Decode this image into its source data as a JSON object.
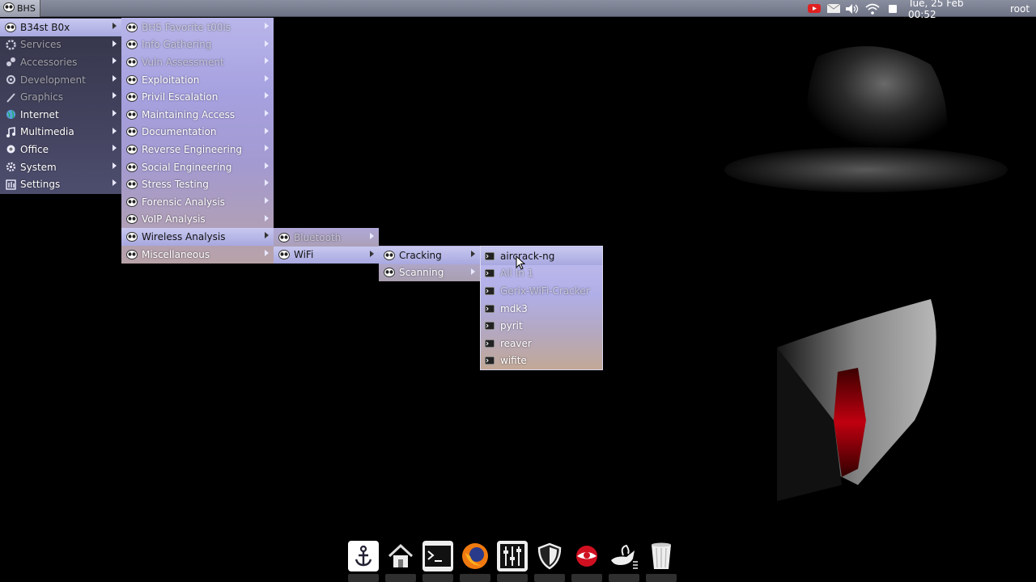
{
  "top_panel": {
    "start_label": "BHS",
    "clock": "Tue, 25 Feb  00:52",
    "user": "root",
    "tray_icons": [
      "youtube-icon",
      "mail-icon",
      "volume-icon",
      "wifi-icon",
      "stop-icon"
    ]
  },
  "main_menu": {
    "items": [
      {
        "label": "B34st B0x",
        "icon": "bhs-icon"
      },
      {
        "label": "Services",
        "icon": "services-icon"
      },
      {
        "label": "Accessories",
        "icon": "accessories-icon"
      },
      {
        "label": "Development",
        "icon": "development-icon"
      },
      {
        "label": "Graphics",
        "icon": "graphics-icon"
      },
      {
        "label": "Internet",
        "icon": "internet-icon"
      },
      {
        "label": "Multimedia",
        "icon": "multimedia-icon"
      },
      {
        "label": "Office",
        "icon": "office-icon"
      },
      {
        "label": "System",
        "icon": "system-icon"
      },
      {
        "label": "Settings",
        "icon": "settings-icon"
      }
    ]
  },
  "bhs_menu": {
    "items": [
      {
        "label": "BHS Favorite t00ls"
      },
      {
        "label": "Info Gathering"
      },
      {
        "label": "Vuln Assessment"
      },
      {
        "label": "Exploitation"
      },
      {
        "label": "Privil Escalation"
      },
      {
        "label": "Maintaining Access"
      },
      {
        "label": "Documentation"
      },
      {
        "label": "Reverse Engineering"
      },
      {
        "label": "Social Engineering"
      },
      {
        "label": "Stress Testing"
      },
      {
        "label": "Forensic Analysis"
      },
      {
        "label": "VoIP Analysis"
      },
      {
        "label": "Wireless Analysis"
      },
      {
        "label": "Miscellaneous"
      }
    ]
  },
  "wireless_menu": {
    "items": [
      {
        "label": "Bluetooth"
      },
      {
        "label": "WiFi"
      }
    ]
  },
  "wifi_menu": {
    "items": [
      {
        "label": "Cracking"
      },
      {
        "label": "Scanning"
      }
    ]
  },
  "cracking_menu": {
    "items": [
      {
        "label": "aircrack-ng"
      },
      {
        "label": "All In 1"
      },
      {
        "label": "Gerix-WiFi-Cracker"
      },
      {
        "label": "mdk3"
      },
      {
        "label": "pyrit"
      },
      {
        "label": "reaver"
      },
      {
        "label": "wifite"
      }
    ]
  },
  "dock": {
    "items": [
      "anchor-icon",
      "home-icon",
      "terminal-icon",
      "firefox-icon",
      "mixer-icon",
      "shield-icon",
      "eye-icon",
      "genie-lamp-icon",
      "trash-icon"
    ]
  }
}
